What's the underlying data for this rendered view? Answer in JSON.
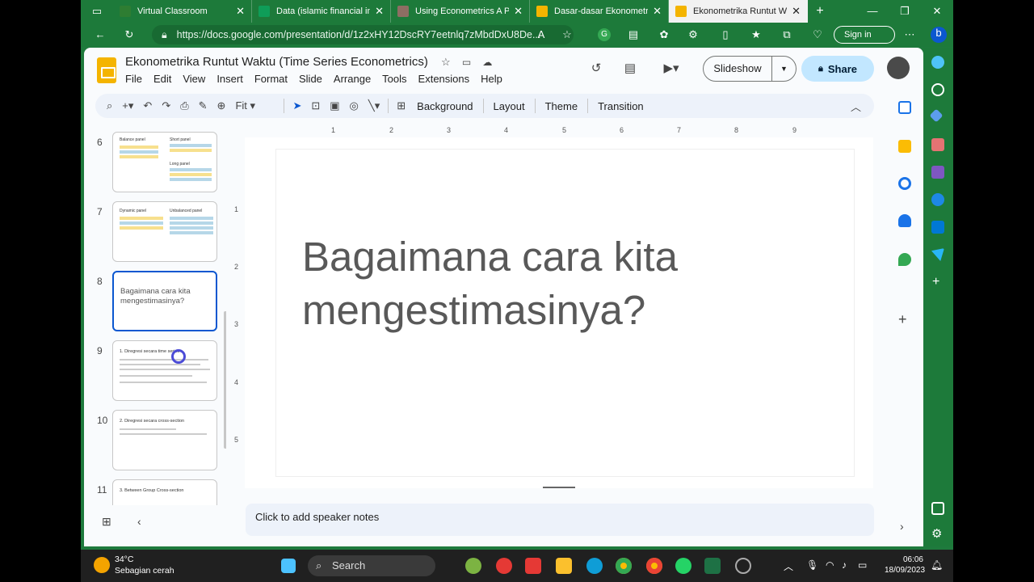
{
  "browser": {
    "tabs": [
      {
        "title": "Virtual Classroom",
        "color": "#2e7d32"
      },
      {
        "title": "Data (islamic financial incl",
        "color": "#0f9d58"
      },
      {
        "title": "Using Econometrics A Pra",
        "color": "#8d6e63"
      },
      {
        "title": "Dasar-dasar Ekonometrika",
        "color": "#f4b400"
      },
      {
        "title": "Ekonometrika Runtut Wak",
        "color": "#f4b400"
      }
    ],
    "url": "https://docs.google.com/presentation/d/1z2xHY12DscRY7eetnlq7zMbdDxU8De...",
    "sign_in": "Sign in"
  },
  "doc": {
    "title": "Ekonometrika Runtut Waktu (Time Series Econometrics)",
    "menus": [
      "File",
      "Edit",
      "View",
      "Insert",
      "Format",
      "Slide",
      "Arrange",
      "Tools",
      "Extensions",
      "Help"
    ],
    "slideshow_label": "Slideshow",
    "share_label": "Share"
  },
  "toolbar": {
    "zoom": "Fit",
    "background": "Background",
    "layout": "Layout",
    "theme": "Theme",
    "transition": "Transition"
  },
  "filmstrip": [
    {
      "num": "6",
      "title_a": "Balance panel",
      "title_b": "Short panel",
      "title_c": "Long panel"
    },
    {
      "num": "7",
      "title_a": "Dynamic panel",
      "title_b": "Unbalanced panel"
    },
    {
      "num": "8",
      "text": "Bagaimana cara kita mengestimasinya?"
    },
    {
      "num": "9",
      "text": "1. Diregresi secara time series"
    },
    {
      "num": "10",
      "text": "2. Diregresi secara cross-section"
    },
    {
      "num": "11",
      "text": "3. Between Group Cross-section"
    }
  ],
  "ruler": {
    "h": [
      "1",
      "2",
      "3",
      "4",
      "5",
      "6",
      "7",
      "8",
      "9"
    ],
    "v": [
      "1",
      "2",
      "3",
      "4",
      "5"
    ]
  },
  "slide": {
    "text": "Bagaimana cara kita mengestimasinya?"
  },
  "notes_placeholder": "Click to add speaker notes",
  "taskbar": {
    "temp": "34°C",
    "weather": "Sebagian cerah",
    "search": "Search",
    "time": "06:06",
    "date": "18/09/2023"
  }
}
